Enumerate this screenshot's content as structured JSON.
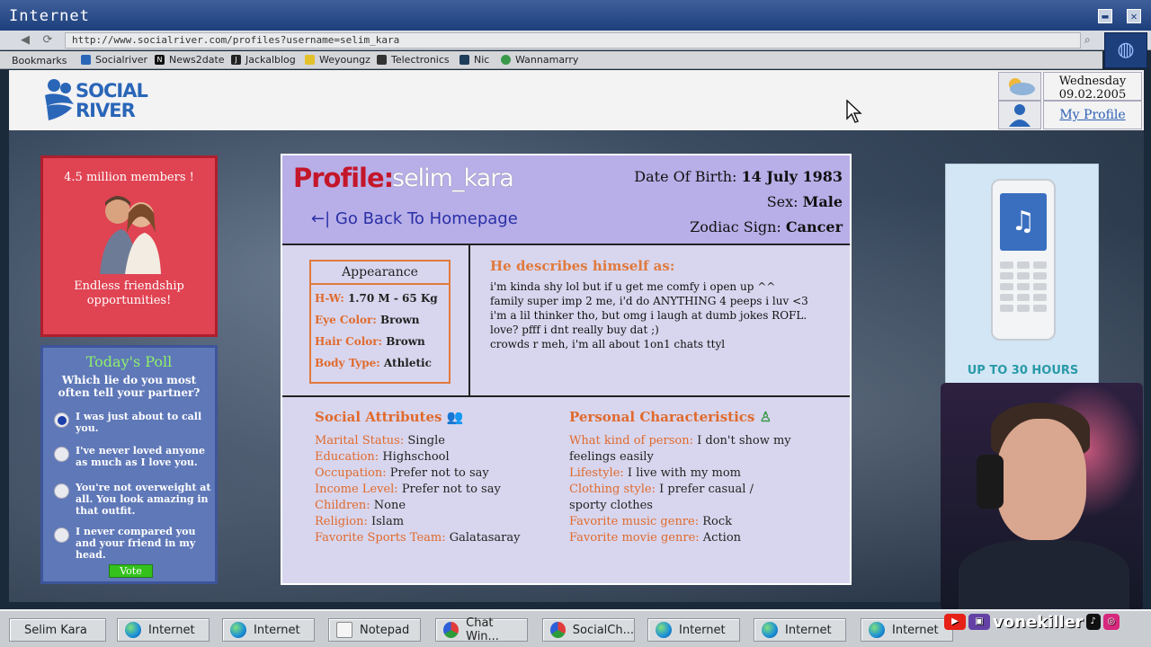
{
  "window": {
    "title": "Internet",
    "minimize": "▬",
    "close": "✕"
  },
  "browser": {
    "url": "http://www.socialriver.com/profiles?username=selim_kara",
    "bookmarks_label": "Bookmarks",
    "bookmarks": [
      "Socialriver",
      "News2date",
      "Jackalblog",
      "Weyoungz",
      "Telectronics",
      "Nic",
      "Wannamarry"
    ]
  },
  "site": {
    "logo_line1": "SOCIAL",
    "logo_line2": "RIVER",
    "date_day": "Wednesday",
    "date_value": "09.02.2005",
    "my_profile": "My Profile"
  },
  "ad_left": {
    "headline": "4.5 million members !",
    "tagline": "Endless friendship opportunities!"
  },
  "poll": {
    "title": "Today's Poll",
    "question": "Which lie do you most often tell your partner?",
    "options": [
      "I was just about to call you.",
      "I've never loved anyone as much as I love you.",
      "You're not overweight at all. You look amazing in that outfit.",
      "I never compared you and your friend in my head."
    ],
    "vote": "Vote"
  },
  "profile": {
    "label": "Profile:",
    "username": "selim_kara",
    "back": "Go Back To Homepage",
    "dob_label": "Date Of Birth:",
    "dob": "14 July 1983",
    "sex_label": "Sex:",
    "sex": "Male",
    "zodiac_label": "Zodiac Sign:",
    "zodiac": "Cancer",
    "appearance_title": "Appearance",
    "appearance": [
      {
        "k": "H-W:",
        "v": "1.70 M - 65 Kg"
      },
      {
        "k": "Eye Color:",
        "v": "Brown"
      },
      {
        "k": "Hair Color:",
        "v": "Brown"
      },
      {
        "k": "Body Type:",
        "v": "Athletic"
      }
    ],
    "describes_title": "He describes himself as:",
    "describes_lines": [
      "i'm kinda shy lol but if u get me comfy i open up ^^",
      "family super imp 2 me, i'd do ANYTHING 4 peeps i luv <3",
      "i'm a lil thinker tho, but omg i laugh at dumb jokes ROFL.",
      "love? pfff i dnt really buy dat ;)",
      "crowds r meh, i'm all about 1on1 chats ttyl"
    ],
    "social_title": "Social Attributes",
    "social": [
      {
        "k": "Marital Status:",
        "v": "Single"
      },
      {
        "k": "Education:",
        "v": "Highschool"
      },
      {
        "k": "Occupation:",
        "v": "Prefer not to say"
      },
      {
        "k": "Income Level:",
        "v": "Prefer not to say"
      },
      {
        "k": "Children:",
        "v": "None"
      },
      {
        "k": "Religion:",
        "v": "Islam"
      },
      {
        "k": "Favorite Sports Team:",
        "v": "Galatasaray"
      }
    ],
    "personal_title": "Personal Characteristics",
    "personal": [
      {
        "k": "What kind of person:",
        "v": "I don't show my feelings easily"
      },
      {
        "k": "Lifestyle:",
        "v": "I live with my mom"
      },
      {
        "k": "Clothing style:",
        "v": "I prefer casual / sporty clothes"
      },
      {
        "k": "Favorite music genre:",
        "v": "Rock"
      },
      {
        "k": "Favorite movie genre:",
        "v": "Action"
      }
    ]
  },
  "ad_right": {
    "caption": "UP TO 30 HOURS"
  },
  "stream": {
    "handle": "vonekiller"
  },
  "taskbar": {
    "start": "Selim Kara",
    "items": [
      {
        "label": "Internet",
        "icon": "globe-icon"
      },
      {
        "label": "Internet",
        "icon": "globe-icon"
      },
      {
        "label": "Notepad",
        "icon": "notepad-icon"
      },
      {
        "label": "Chat Win...",
        "icon": "chat-icon"
      },
      {
        "label": "SocialCh...",
        "icon": "chat-icon"
      },
      {
        "label": "Internet",
        "icon": "globe-icon"
      },
      {
        "label": "Internet",
        "icon": "globe-icon"
      },
      {
        "label": "Internet",
        "icon": "globe-icon"
      }
    ]
  },
  "colors": {
    "accent_orange": "#e06a2d",
    "profile_red": "#c4162a",
    "link_blue": "#2a2fa6"
  }
}
